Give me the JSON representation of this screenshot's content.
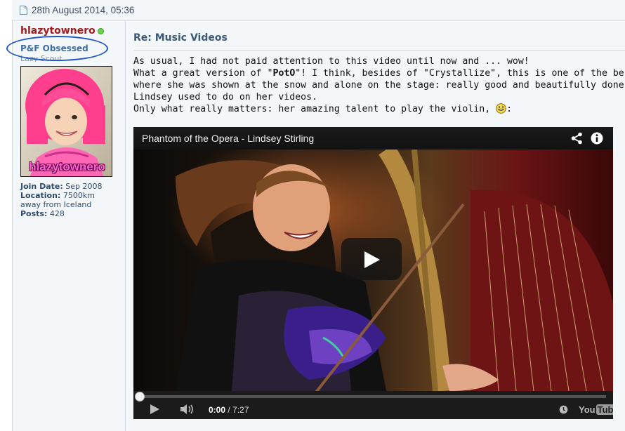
{
  "post": {
    "date": "28th August 2014, 05:36",
    "title": "Re: Music Videos",
    "body": {
      "line1": "As usual, I had not paid attention to this video until now and ... wow!",
      "line2a": "What a great version of \"",
      "line2_bold": "PotO",
      "line2b": "\"! I think, besides of \"Crystallize\", this is one of the best Lindsey Stirling videos,",
      "line3": "where she was shown at the snow and alone on the stage: really good and beautifully done. And as",
      "line4": "Lindsey used to do on her videos.",
      "line5": "Only what really matters: her amazing talent to play the violin, ",
      "line5_end": ":"
    }
  },
  "user": {
    "name": "hlazytownero",
    "title": "P&F Obsessed",
    "rank": "Lazy Scout",
    "avatar_caption": "hlazytownero",
    "info": [
      {
        "label": "Join Date:",
        "value": "Sep 2008"
      },
      {
        "label": "Location:",
        "value": "7500km away from Iceland"
      },
      {
        "label": "Posts:",
        "value": "428"
      }
    ]
  },
  "video": {
    "title": "Phantom of the Opera - Lindsey Stirling",
    "current_time": "0:00",
    "separator": " / ",
    "duration": "7:27",
    "progress": 0,
    "logo_you": "You",
    "logo_tube": "Tube"
  },
  "colors": {
    "username": "#a01a1a",
    "user_title": "#3a6ea5",
    "annotation_oval": "#1f55c9",
    "post_title": "#3b5a7a"
  }
}
